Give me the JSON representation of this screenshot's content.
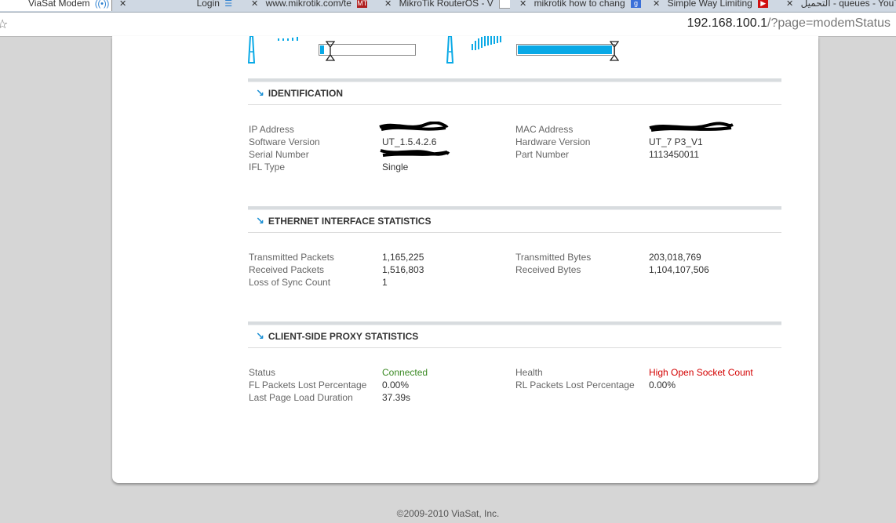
{
  "browser": {
    "tabs": [
      {
        "label": "ViaSat Modem"
      },
      {
        "label": "Login"
      },
      {
        "label": "www.mikrotik.com/te"
      },
      {
        "label": "MikroTik RouterOS - V"
      },
      {
        "label": "mikrotik how to chang"
      },
      {
        "label": "Simple Way Limiting"
      },
      {
        "label": "التحميل - queues - YouT"
      }
    ],
    "url_host": "192.168.100.1",
    "url_path": "/?page=modemStatus"
  },
  "signal": {
    "receive_level": 0.04,
    "transmit_level": 0.98
  },
  "identification": {
    "title": "IDENTIFICATION",
    "ip_address_label": "IP Address",
    "software_version_label": "Software Version",
    "software_version": "UT_1.5.4.2.6",
    "serial_number_label": "Serial Number",
    "ifl_type_label": "IFL Type",
    "ifl_type": "Single",
    "mac_address_label": "MAC Address",
    "hardware_version_label": "Hardware Version",
    "hardware_version": "UT_7 P3_V1",
    "part_number_label": "Part Number",
    "part_number": "1113450011"
  },
  "ethernet": {
    "title": "ETHERNET INTERFACE STATISTICS",
    "tx_packets_label": "Transmitted Packets",
    "tx_packets": "1,165,225",
    "rx_packets_label": "Received Packets",
    "rx_packets": "1,516,803",
    "loss_sync_label": "Loss of Sync Count",
    "loss_sync": "1",
    "tx_bytes_label": "Transmitted Bytes",
    "tx_bytes": "203,018,769",
    "rx_bytes_label": "Received Bytes",
    "rx_bytes": "1,104,107,506"
  },
  "proxy": {
    "title": "CLIENT-SIDE PROXY STATISTICS",
    "status_label": "Status",
    "status": "Connected",
    "fl_lost_label": "FL Packets Lost Percentage",
    "fl_lost": "0.00%",
    "last_load_label": "Last Page Load Duration",
    "last_load": "37.39s",
    "health_label": "Health",
    "health": "High Open Socket Count",
    "rl_lost_label": "RL Packets Lost Percentage",
    "rl_lost": "0.00%"
  },
  "colors": {
    "accent": "#09a9e6",
    "status_ok": "#3b8a24",
    "status_warn": "#d30000"
  },
  "footer": "©2009-2010 ViaSat, Inc."
}
